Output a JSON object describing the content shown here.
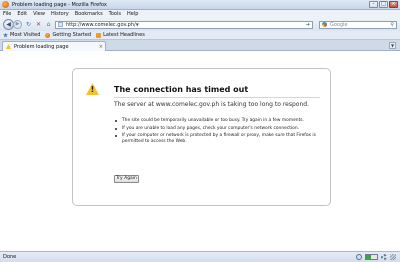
{
  "window": {
    "title": "Problem loading page - Mozilla Firefox",
    "buttons": [
      "–",
      "□",
      "×"
    ]
  },
  "menu": [
    "File",
    "Edit",
    "View",
    "History",
    "Bookmarks",
    "Tools",
    "Help"
  ],
  "navigation": {
    "url": "http://www.comelec.gov.ph/",
    "search_placeholder": "Google"
  },
  "bookmarks": [
    "Most Visited",
    "Getting Started",
    "Latest Headlines"
  ],
  "tab": {
    "label": "Problem loading page",
    "close": "×"
  },
  "error": {
    "title": "The connection has timed out",
    "subtitle": "The server at www.comelec.gov.ph is taking too long to respond.",
    "bullets": [
      "The site could be temporarily unavailable or too busy. Try again in a few moments.",
      "If you are unable to load any pages, check your computer's network connection.",
      "If your computer or network is protected by a firewall or proxy, make sure that Firefox is permitted to access the Web."
    ],
    "button": "Try Again"
  },
  "status": {
    "text": "Done"
  },
  "icons": {
    "app": "firefox-icon",
    "back": "back-arrow-icon",
    "forward": "forward-arrow-icon",
    "reload": "reload-icon",
    "stop": "stop-icon",
    "home": "home-icon",
    "warning": "warning-icon",
    "search": "search-icon"
  },
  "colors": {
    "chrome": "#dbe4ef",
    "warning": "#f2c230",
    "background": "#ffffff"
  }
}
